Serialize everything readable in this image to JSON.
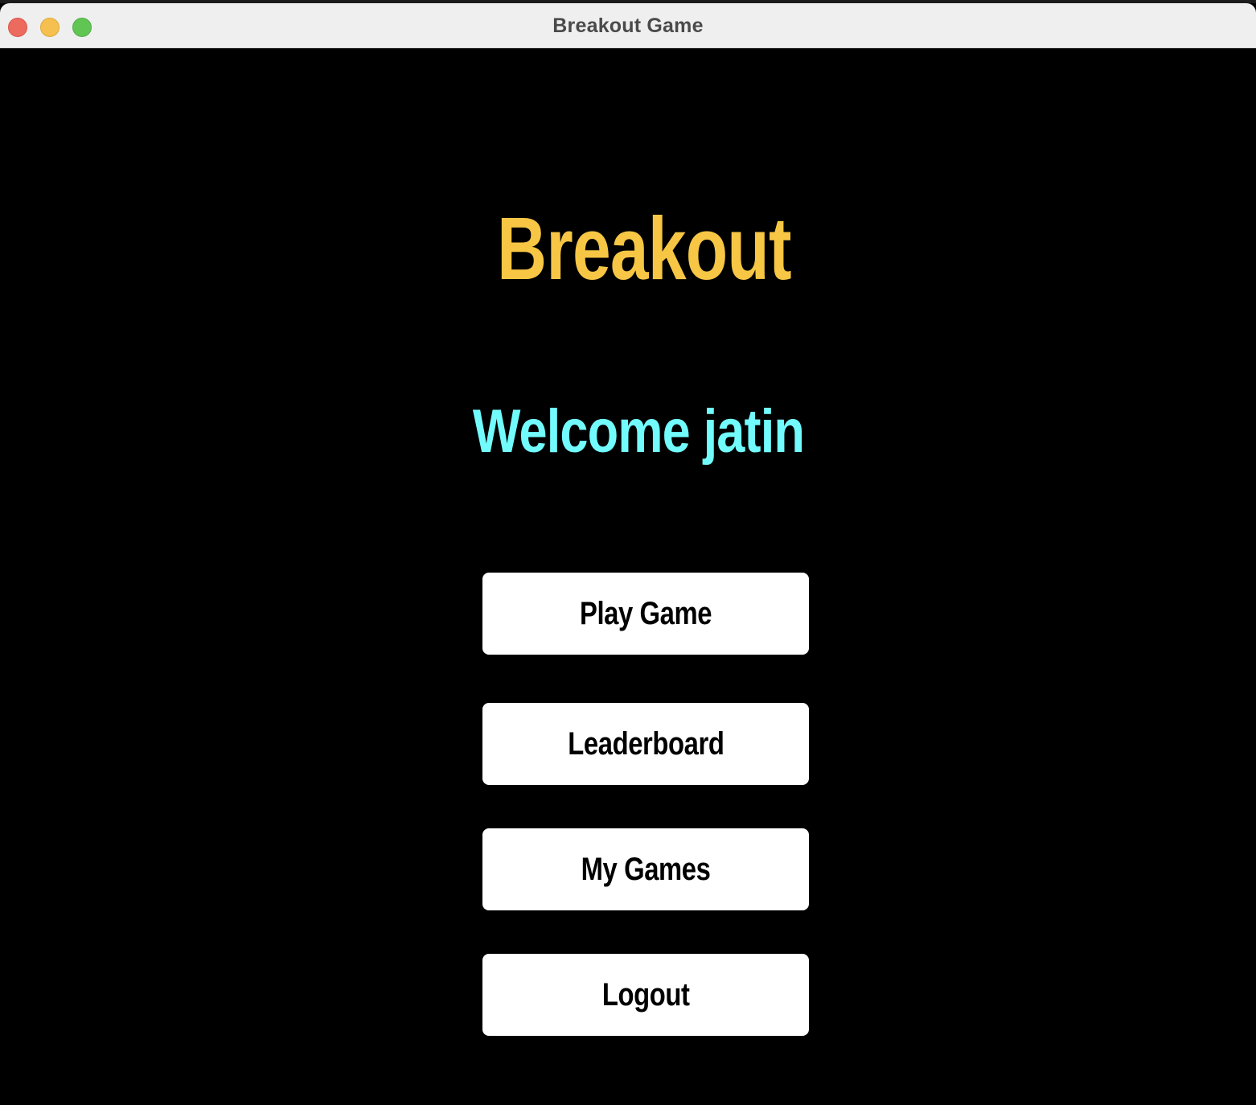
{
  "window": {
    "title": "Breakout Game"
  },
  "main": {
    "game_title": "Breakout",
    "welcome_text": "Welcome jatin"
  },
  "menu": {
    "play_label": "Play Game",
    "leaderboard_label": "Leaderboard",
    "my_games_label": "My Games",
    "logout_label": "Logout"
  },
  "colors": {
    "background": "#000000",
    "title": "#f6c644",
    "welcome": "#72fbfd",
    "button_bg": "#ffffff",
    "button_text": "#000000"
  },
  "icons": {
    "close": "close-icon",
    "minimize": "minimize-icon",
    "zoom": "zoom-icon"
  }
}
